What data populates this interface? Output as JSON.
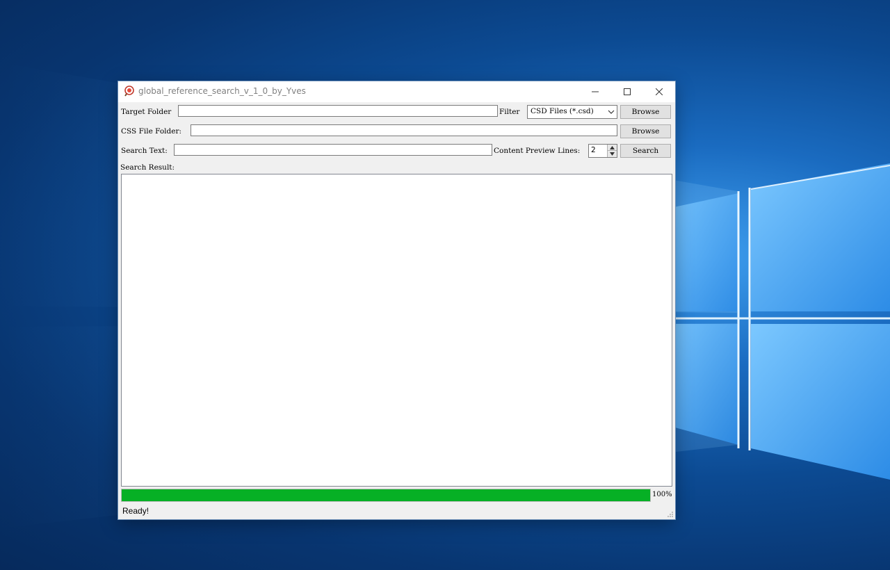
{
  "window": {
    "title": "global_reference_search_v_1_0_by_Yves"
  },
  "form": {
    "target_folder_label": "Target Folder",
    "target_folder_value": "",
    "filter_label": "Filter",
    "filter_selected": "CSD Files (*.csd)",
    "browse_target_label": "Browse",
    "css_folder_label": "CSS File Folder:",
    "css_folder_value": "",
    "browse_css_label": "Browse",
    "search_text_label": "Search Text:",
    "search_text_value": "",
    "preview_lines_label": "Content Preview Lines:",
    "preview_lines_value": "2",
    "search_button_label": "Search"
  },
  "results": {
    "label": "Search Result:",
    "content": ""
  },
  "progress": {
    "value_fraction": 1.0,
    "percent_text": "100%",
    "color": "#06b025"
  },
  "status": {
    "text": "Ready!"
  },
  "icons": {
    "app": "app-logo-icon",
    "minimize": "minimize-icon",
    "maximize": "maximize-icon",
    "close": "close-icon",
    "dropdown": "chevron-down-icon",
    "spin_up": "spin-up-icon",
    "spin_down": "spin-down-icon",
    "grip": "resize-grip-icon"
  }
}
